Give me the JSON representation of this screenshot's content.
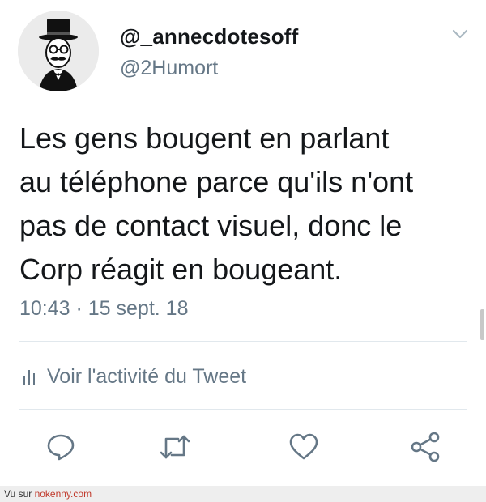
{
  "header": {
    "display_name": "@_annecdotesoff",
    "handle": "@2Humort",
    "avatar_icon": "top-hat-gentleman-icon",
    "menu_icon": "chevron-down-icon"
  },
  "tweet": {
    "text": "Les gens bougent en parlant\nau téléphone parce qu'ils n'ont\npas de contact visuel, donc le\nCorp réagit en bougeant.",
    "timestamp": "10:43 · 15 sept. 18"
  },
  "activity": {
    "icon": "bar-chart-icon",
    "label": "Voir l'activité du Tweet"
  },
  "actions": [
    {
      "name": "reply",
      "icon": "reply-icon"
    },
    {
      "name": "retweet",
      "icon": "retweet-icon"
    },
    {
      "name": "like",
      "icon": "heart-icon"
    },
    {
      "name": "share",
      "icon": "share-icon"
    }
  ],
  "footer": {
    "prefix": "Vu sur ",
    "link": "nokenny.com"
  },
  "colors": {
    "text_primary": "#14171a",
    "text_secondary": "#657786",
    "divider": "#e1e8ed",
    "footer_link": "#c0392b"
  }
}
